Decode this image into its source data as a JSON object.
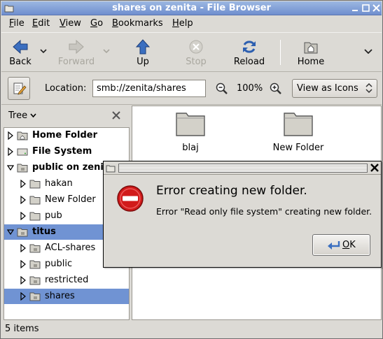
{
  "window": {
    "title": "shares on zenita - File Browser",
    "buttons": [
      "minimize",
      "maximize",
      "close"
    ]
  },
  "menubar": {
    "items": [
      {
        "label": "File",
        "accel": "F",
        "rest": "ile"
      },
      {
        "label": "Edit",
        "accel": "E",
        "rest": "dit"
      },
      {
        "label": "View",
        "accel": "V",
        "rest": "iew"
      },
      {
        "label": "Go",
        "accel": "G",
        "rest": "o"
      },
      {
        "label": "Bookmarks",
        "accel": "B",
        "rest": "ookmarks"
      },
      {
        "label": "Help",
        "accel": "H",
        "rest": "elp"
      }
    ]
  },
  "toolbar": {
    "back": "Back",
    "forward": "Forward",
    "up": "Up",
    "stop": "Stop",
    "reload": "Reload",
    "home": "Home"
  },
  "location": {
    "label": "Location:",
    "value": "smb://zenita/shares",
    "zoom": "100%",
    "view_mode": "View as Icons"
  },
  "sidebar": {
    "header": "Tree",
    "items": [
      {
        "label": "Home Folder",
        "expanded": false,
        "bold": true,
        "depth": 0,
        "icon": "home-folder-icon"
      },
      {
        "label": "File System",
        "expanded": false,
        "bold": true,
        "depth": 0,
        "icon": "drive-icon"
      },
      {
        "label": "public on zenita",
        "expanded": true,
        "bold": true,
        "depth": 0,
        "icon": "network-folder-icon"
      },
      {
        "label": "hakan",
        "expanded": false,
        "bold": false,
        "depth": 1,
        "icon": "folder-icon"
      },
      {
        "label": "New Folder",
        "expanded": false,
        "bold": false,
        "depth": 1,
        "icon": "folder-icon"
      },
      {
        "label": "pub",
        "expanded": false,
        "bold": false,
        "depth": 1,
        "icon": "folder-icon"
      },
      {
        "label": "titus",
        "expanded": true,
        "bold": true,
        "depth": 0,
        "icon": "network-folder-icon",
        "selected": true
      },
      {
        "label": "ACL-shares",
        "expanded": false,
        "bold": false,
        "depth": 1,
        "icon": "network-folder-icon"
      },
      {
        "label": "public",
        "expanded": false,
        "bold": false,
        "depth": 1,
        "icon": "network-folder-icon"
      },
      {
        "label": "restricted",
        "expanded": false,
        "bold": false,
        "depth": 1,
        "icon": "network-folder-icon"
      },
      {
        "label": "shares",
        "expanded": false,
        "bold": false,
        "depth": 1,
        "icon": "network-folder-icon",
        "selected": true
      }
    ]
  },
  "main": {
    "files": [
      {
        "name": "blaj"
      },
      {
        "name": "New Folder"
      }
    ]
  },
  "statusbar": {
    "text": "5 items"
  },
  "dialog": {
    "heading": "Error creating new folder.",
    "message": "Error \"Read only file system\" creating new folder.",
    "ok_accel": "O",
    "ok_rest": "K"
  },
  "colors": {
    "titlebar": "#7f9fd8",
    "selection": "#7093d3",
    "error_red": "#d11a1a"
  }
}
